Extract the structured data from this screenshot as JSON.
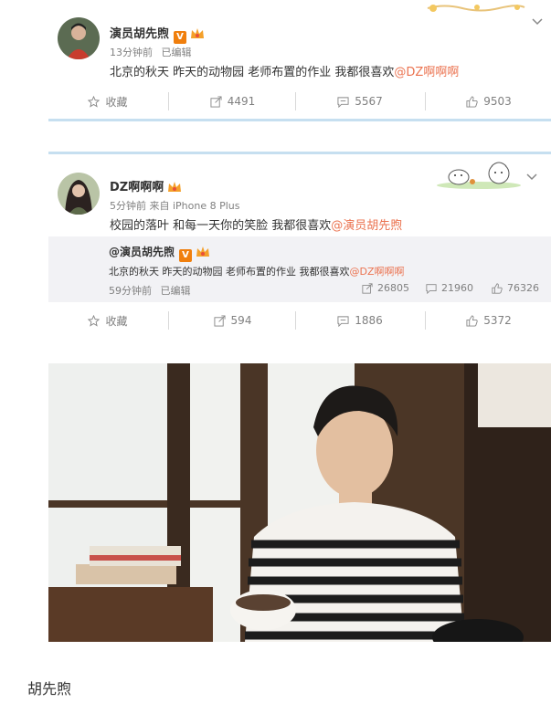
{
  "post1": {
    "username": "演员胡先煦",
    "verified_badge": "V",
    "time": "13分钟前",
    "edited": "已编辑",
    "text": "北京的秋天 昨天的动物园 老师布置的作业 我都很喜欢",
    "mention": "@DZ啊啊啊",
    "actions": {
      "favorite_label": "收藏",
      "repost_count": "4491",
      "comment_count": "5567",
      "like_count": "9503"
    }
  },
  "post2": {
    "username": "DZ啊啊啊",
    "time": "5分钟前 来自 iPhone 8 Plus",
    "text": "校园的落叶 和每一天你的笑脸 我都很喜欢",
    "mention": "@演员胡先煦",
    "quoted": {
      "username": "@演员胡先煦",
      "verified_badge": "V",
      "text": "北京的秋天 昨天的动物园 老师布置的作业 我都很喜欢",
      "mention": "@DZ啊啊啊",
      "time": "59分钟前",
      "edited": "已编辑",
      "repost_count": "26805",
      "comment_count": "21960",
      "like_count": "76326"
    },
    "actions": {
      "favorite_label": "收藏",
      "repost_count": "594",
      "comment_count": "1886",
      "like_count": "5372"
    }
  },
  "caption": "胡先煦",
  "colors": {
    "mention": "#eb7350",
    "separator_bar": "#c6dff0",
    "quote_bg": "#f2f2f5",
    "vip_badge": "#f07f0d"
  },
  "icons": [
    "star-icon",
    "repost-icon",
    "comment-icon",
    "like-icon",
    "chevron-down-icon",
    "crown-icon"
  ]
}
